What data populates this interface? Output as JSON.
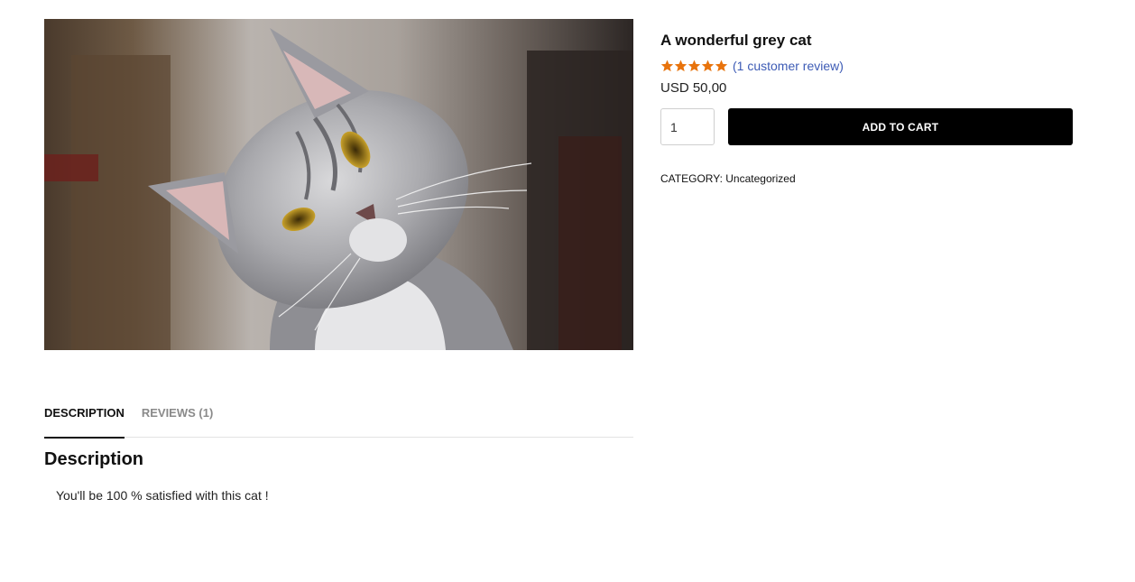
{
  "product": {
    "title": "A wonderful grey cat",
    "rating": {
      "value": 5,
      "max": 5,
      "star_color": "#e8730c"
    },
    "review_link": "(1 customer review)",
    "price": "USD 50,00",
    "quantity": "1",
    "add_to_cart_label": "ADD TO CART",
    "category_label": "CATEGORY:",
    "category_value": "Uncategorized"
  },
  "tabs": [
    {
      "label": "DESCRIPTION",
      "active": true
    },
    {
      "label": "REVIEWS (1)",
      "active": false
    }
  ],
  "description": {
    "heading": "Description",
    "text": "You'll be 100 % satisfied with this cat !"
  },
  "colors": {
    "link": "#3d5bb5",
    "button_bg": "#000000",
    "button_text": "#ffffff"
  }
}
